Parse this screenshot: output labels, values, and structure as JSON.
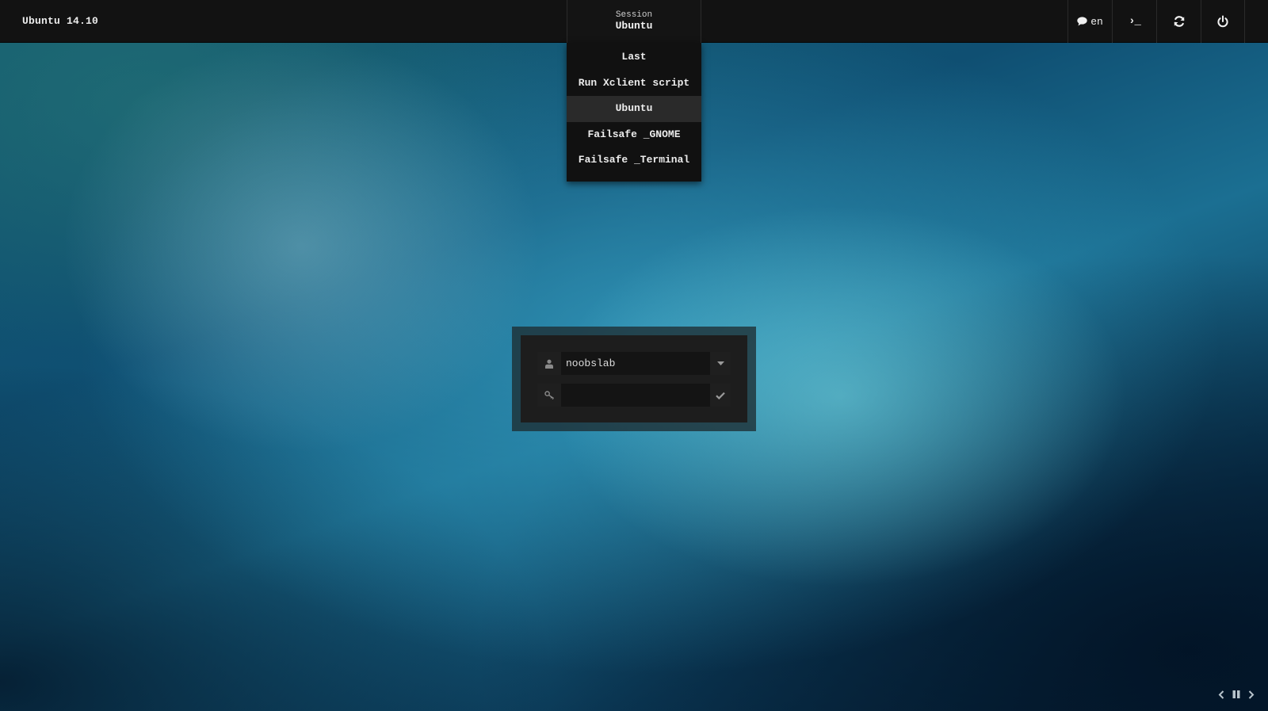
{
  "top_bar": {
    "distro_label": "Ubuntu 14.10",
    "session": {
      "caption": "Session",
      "current": "Ubuntu"
    },
    "language": {
      "icon": "speech-bubble-icon",
      "label": "en"
    },
    "terminal": {
      "icon": "terminal-prompt-icon",
      "glyph": "›_"
    },
    "refresh": {
      "icon": "refresh-icon"
    },
    "power": {
      "icon": "power-icon"
    }
  },
  "session_menu": {
    "items": [
      {
        "label": "Last"
      },
      {
        "label": "Run Xclient script"
      },
      {
        "label": "Ubuntu",
        "selected": true
      },
      {
        "label": "Failsafe _GNOME"
      },
      {
        "label": "Failsafe _Terminal"
      }
    ]
  },
  "login": {
    "username": {
      "icon": "user-icon",
      "value": "noobslab",
      "dropdown_icon": "caret-down-icon"
    },
    "password": {
      "icon": "key-icon",
      "value": "",
      "submit_icon": "checkmark-icon"
    }
  },
  "slideshow": {
    "prev_icon": "chevron-left-icon",
    "pause_icon": "pause-icon",
    "next_icon": "chevron-right-icon"
  },
  "colors": {
    "panel": "#121212",
    "menu_bg": "#111111",
    "menu_selected": "#2a2a2a",
    "text": "#ececec",
    "wallpaper_base": "#0d3f5c"
  }
}
